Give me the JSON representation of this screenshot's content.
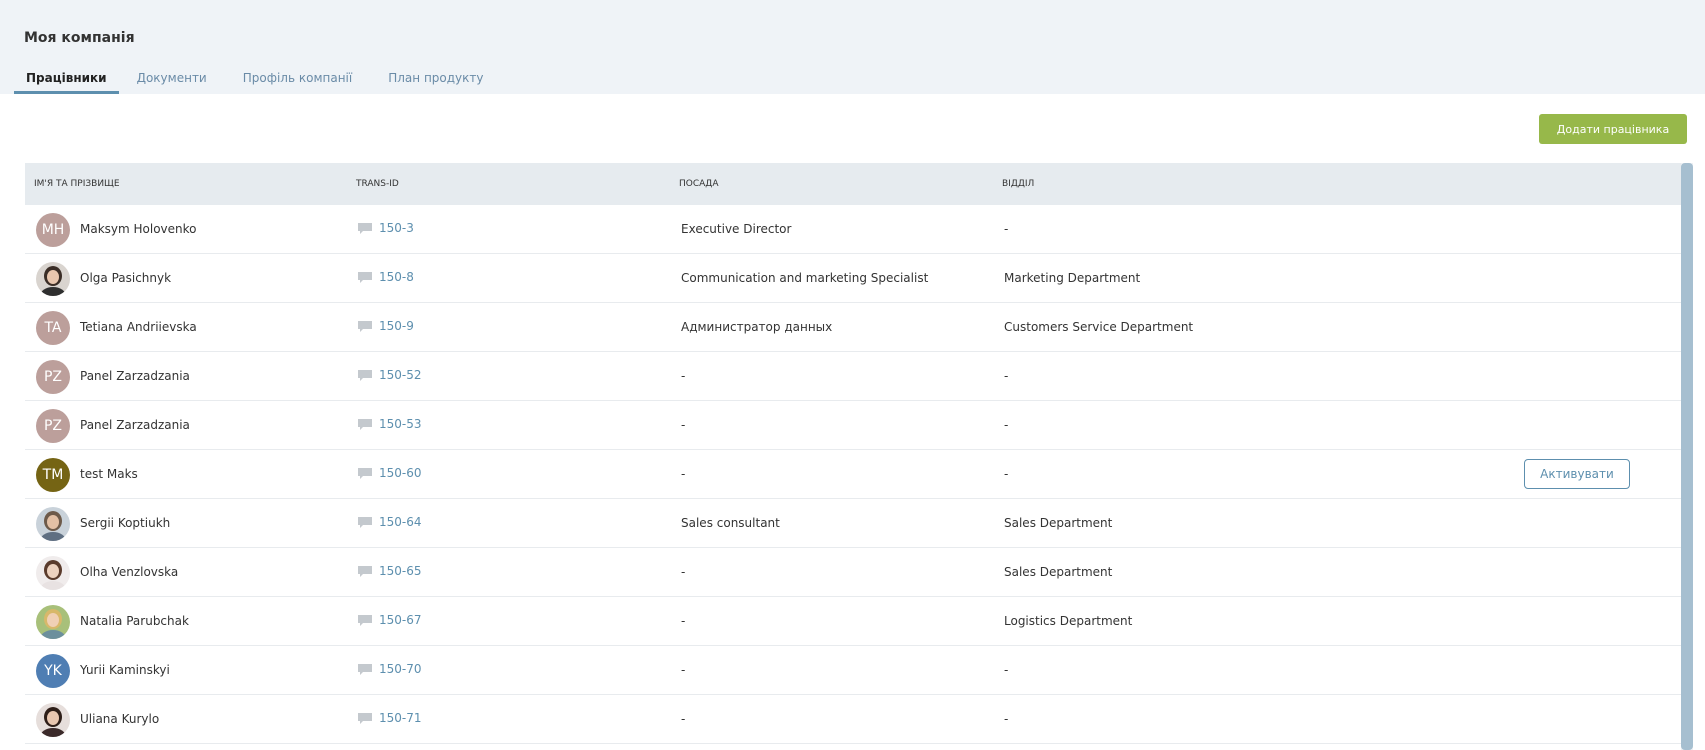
{
  "header": {
    "title": "Моя компанія",
    "tabs": [
      {
        "label": "Працівники",
        "active": true
      },
      {
        "label": "Документи",
        "active": false
      },
      {
        "label": "Профіль компанії",
        "active": false
      },
      {
        "label": "План продукту",
        "active": false
      }
    ]
  },
  "toolbar": {
    "add_label": "Додати працівника"
  },
  "colors": {
    "accent": "#5d8fae",
    "add_button": "#97b84a",
    "header_bg": "#eff3f7",
    "table_header_bg": "#e6ebef"
  },
  "table": {
    "columns": [
      "ІМ'Я ТА ПРІЗВИЩЕ",
      "TRANS-ID",
      "ПОСАДА",
      "ВІДДІЛ"
    ],
    "activate_label": "Активувати",
    "rows": [
      {
        "initials": "MH",
        "name": "Maksym Holovenko",
        "trans_id": "150-3",
        "position": "Executive Director",
        "department": "-",
        "avatar": "initials",
        "avatar_color": "#bc9f9b"
      },
      {
        "initials": "",
        "name": "Olga Pasichnyk",
        "trans_id": "150-8",
        "position": "Communication and marketing Specialist",
        "department": "Marketing Department",
        "avatar": "photo"
      },
      {
        "initials": "TA",
        "name": "Tetiana Andriievska",
        "trans_id": "150-9",
        "position": "Администратор данных",
        "department": "Customers Service Department",
        "avatar": "initials",
        "avatar_color": "#bc9f9b"
      },
      {
        "initials": "PZ",
        "name": "Panel Zarzadzania",
        "trans_id": "150-52",
        "position": "-",
        "department": "-",
        "avatar": "initials",
        "avatar_color": "#bc9f9b"
      },
      {
        "initials": "PZ",
        "name": "Panel Zarzadzania",
        "trans_id": "150-53",
        "position": "-",
        "department": "-",
        "avatar": "initials",
        "avatar_color": "#bc9f9b"
      },
      {
        "initials": "TM",
        "name": "test Maks",
        "trans_id": "150-60",
        "position": "-",
        "department": "-",
        "avatar": "initials",
        "avatar_color": "#756414",
        "activate": true
      },
      {
        "initials": "",
        "name": "Sergii Koptiukh",
        "trans_id": "150-64",
        "position": "Sales consultant",
        "department": "Sales Department",
        "avatar": "photo"
      },
      {
        "initials": "",
        "name": "Olha Venzlovska",
        "trans_id": "150-65",
        "position": "-",
        "department": "Sales Department",
        "avatar": "photo"
      },
      {
        "initials": "",
        "name": "Natalia Parubchak",
        "trans_id": "150-67",
        "position": "-",
        "department": "Logistics Department",
        "avatar": "photo"
      },
      {
        "initials": "YK",
        "name": "Yurii Kaminskyi",
        "trans_id": "150-70",
        "position": "-",
        "department": "-",
        "avatar": "initials",
        "avatar_color": "#4f7eb3"
      },
      {
        "initials": "",
        "name": "Uliana Kurylo",
        "trans_id": "150-71",
        "position": "-",
        "department": "-",
        "avatar": "photo"
      }
    ]
  }
}
